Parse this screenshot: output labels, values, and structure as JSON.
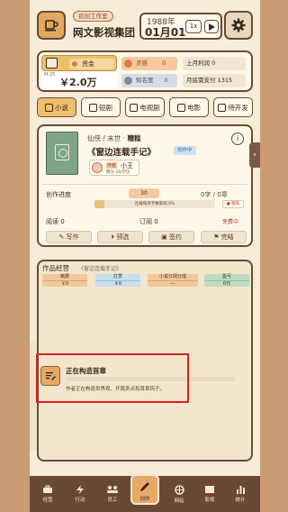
{
  "header": {
    "studio_badge": "初创工作室",
    "studio_name": "网文影视集团",
    "year": "1988年",
    "month_day": "01月01",
    "speed": "1x"
  },
  "stats": {
    "money_label": "资金",
    "money_sub": "M:25",
    "money_value": "￥2.0万",
    "fame_label": "灵感",
    "fame_value": "0",
    "known_label": "知名度",
    "known_value": "0",
    "monthly_profit": "上月利润 0",
    "monthly_pay": "月底需支付 1315"
  },
  "tabs": [
    {
      "label": "小说",
      "icon": "book-icon"
    },
    {
      "label": "短剧",
      "icon": "short-drama-icon"
    },
    {
      "label": "电视剧",
      "icon": "tv-icon"
    },
    {
      "label": "电影",
      "icon": "film-icon"
    },
    {
      "label": "待开发",
      "icon": "gamepad-icon"
    }
  ],
  "project": {
    "genre_prefix": "仙侠 / 末世 · ",
    "genre_main": "糟糕",
    "title": "《窗边连载手记》",
    "status": "创作中",
    "writer_role": "作者",
    "writer_name": "小王",
    "writer_stats": "腾文·28/学历",
    "info_icon": "i",
    "progress_label": "创作进度",
    "progress_chip": "30",
    "word_count": "0字 / 0章",
    "progress_text": "连载每月字数影响 0%",
    "progress_fraction": 0.08,
    "release_label": "● 发布",
    "reads": "阅读 0",
    "subs": "订阅 0",
    "free": "免费中",
    "actions": [
      "写作",
      "预选",
      "签约",
      "完结"
    ]
  },
  "operations": {
    "title": "作品经营",
    "subtitle": "《窗边连载手记》",
    "columns": [
      {
        "label": "稿费",
        "value": "￥0"
      },
      {
        "label": "打赏",
        "value": "￥0"
      },
      {
        "label": "小说订阅分成",
        "value": "---"
      },
      {
        "label": "盈亏",
        "value": "0元"
      }
    ]
  },
  "notice": {
    "title": "正在构造首章",
    "text": "作者正在构造世界观、开篇卖点和首章钩子。"
  },
  "nav": {
    "items": [
      "经营",
      "行动",
      "员工",
      "创作",
      "网站",
      "影视",
      "统计"
    ]
  },
  "colors": {
    "accent": "#eebf6c",
    "border": "#6b4a33",
    "highlight": "#e01f1f",
    "nav_bg": "#6a4934"
  }
}
